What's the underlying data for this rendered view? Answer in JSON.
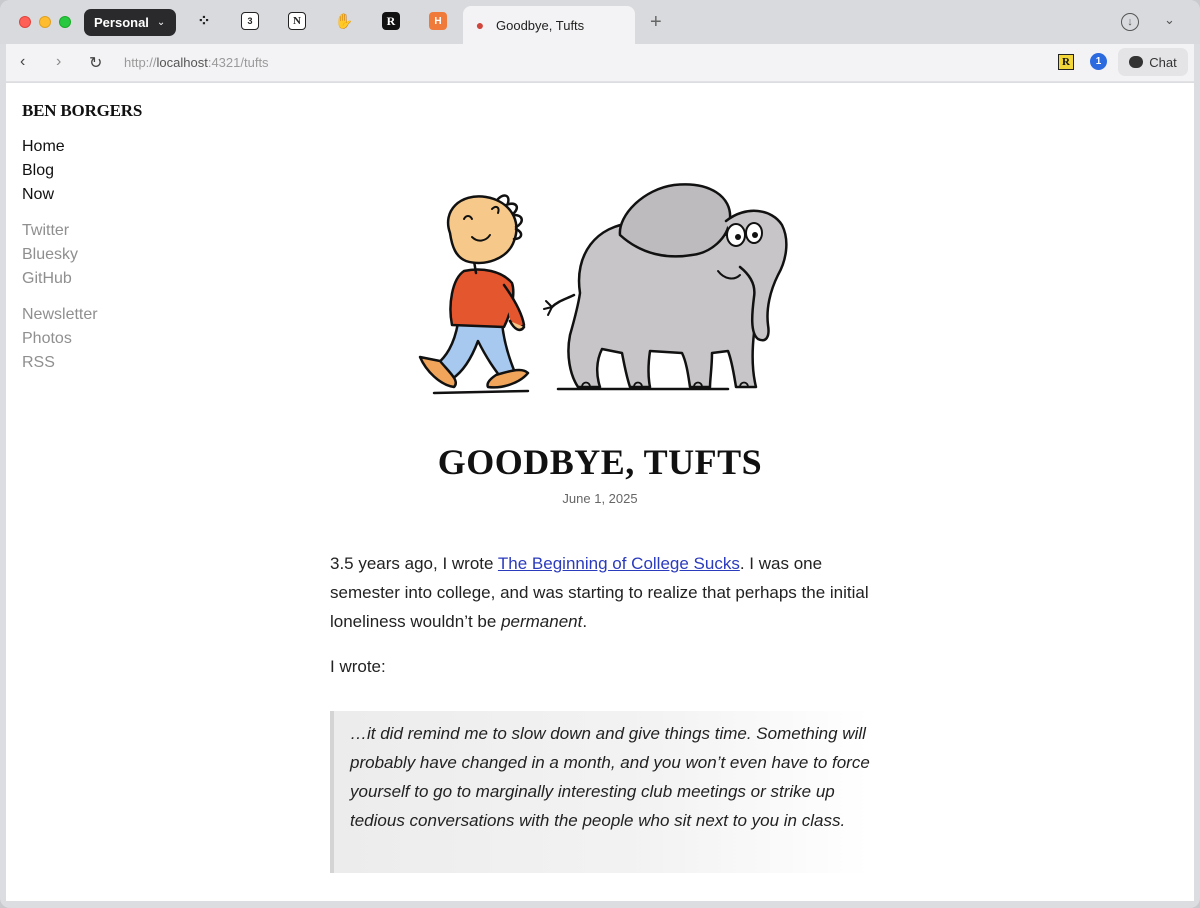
{
  "browser": {
    "profile_label": "Personal",
    "active_tab_title": "Goodbye, Tufts",
    "url_scheme": "http://",
    "url_host": "localhost",
    "url_rest": ":4321/tufts",
    "chat_label": "Chat",
    "pinned_tabs": [
      "apps-icon",
      "calendar-icon",
      "notion-icon",
      "hand-icon",
      "r-icon",
      "h-icon"
    ]
  },
  "sidebar": {
    "site_title": "BEN BORGERS",
    "primary_links": [
      "Home",
      "Blog",
      "Now"
    ],
    "social_links": [
      "Twitter",
      "Bluesky",
      "GitHub"
    ],
    "other_links": [
      "Newsletter",
      "Photos",
      "RSS"
    ]
  },
  "post": {
    "title": "GOODBYE, TUFTS",
    "date": "June 1, 2025",
    "p1_before": "3.5 years ago, I wrote ",
    "p1_link": "The Beginning of College Sucks",
    "p1_after": ". I was one semester into college, and was starting to realize that perhaps the initial loneliness wouldn’t be ",
    "p1_em": "permanent",
    "p1_end": ".",
    "p2": "I wrote:",
    "quote": "…it did remind me to slow down and give things time. Something will probably have changed in a month, and you won’t even have to force yourself to go to marginally interesting club meetings or strike up tedious conversations with the people who sit next to you in class."
  }
}
